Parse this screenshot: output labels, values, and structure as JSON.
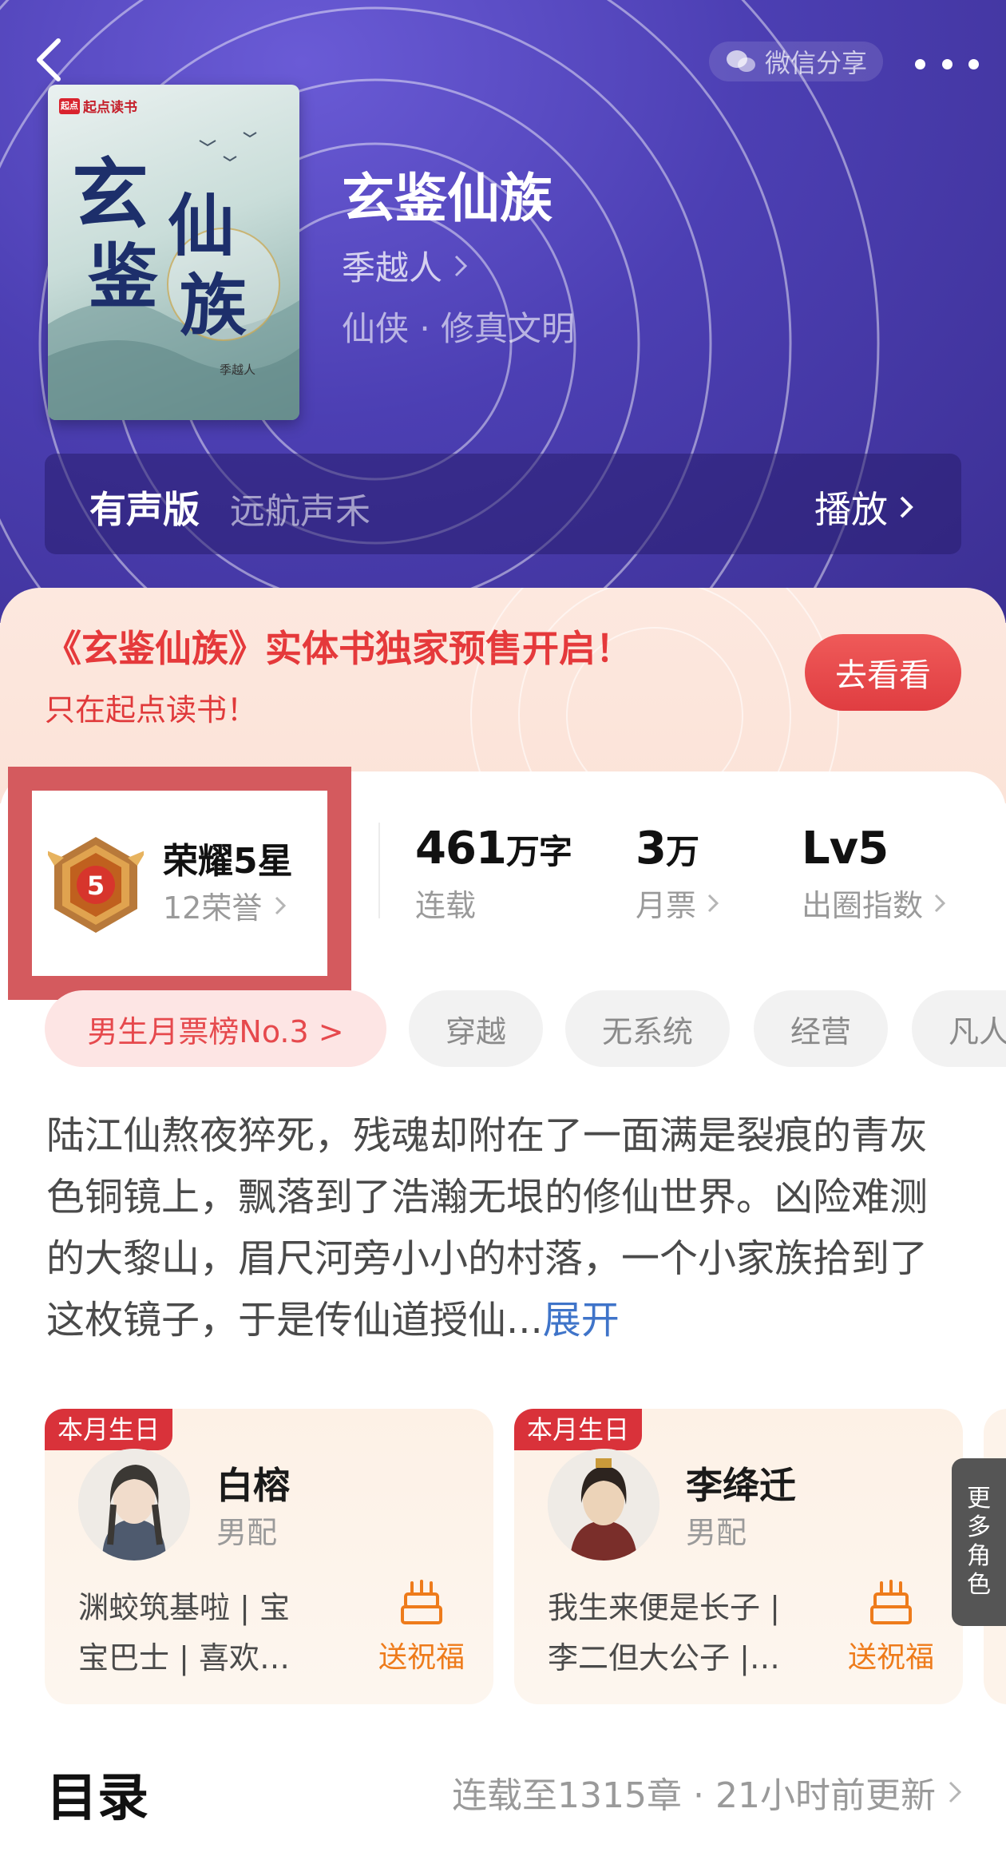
{
  "nav": {
    "share_label": "微信分享"
  },
  "book": {
    "cover_brand": "起点读书",
    "cover_brand_mark": "起点",
    "cover_title_chars": [
      "玄",
      "鉴",
      "仙",
      "族"
    ],
    "cover_author": "季越人",
    "title": "玄鉴仙族",
    "author": "季越人",
    "genre": "仙侠 · 修真文明"
  },
  "audio": {
    "label": "有声版",
    "narrator": "远航声禾",
    "play_label": "播放"
  },
  "promo": {
    "title": "《玄鉴仙族》实体书独家预售开启！",
    "subtitle": "只在起点读书！",
    "button": "去看看"
  },
  "honor": {
    "title": "荣耀5星",
    "subtitle": "12荣誉",
    "medal_level": "5"
  },
  "stats": [
    {
      "value": "461",
      "unit": "万字",
      "label": "连载"
    },
    {
      "value": "3",
      "unit": "万",
      "label": "月票"
    },
    {
      "value": "Lv5",
      "unit": "",
      "label": "出圈指数"
    }
  ],
  "tags": [
    "男生月票榜No.3 >",
    "穿越",
    "无系统",
    "经营",
    "凡人"
  ],
  "synopsis": {
    "text": "陆江仙熬夜猝死，残魂却附在了一面满是裂痕的青灰色铜镜上，飘落到了浩瀚无垠的修仙世界。凶险难测的大黎山，眉尺河旁小小的村落，一个小家族拾到了这枚镜子，于是传仙道授仙...",
    "expand": "展开"
  },
  "characters": [
    {
      "badge": "本月生日",
      "name": "白榕",
      "role": "男配",
      "desc_line1": "渊蛟筑基啦 | 宝",
      "desc_line2": "宝巴士 | 喜欢…",
      "bless": "送祝福"
    },
    {
      "badge": "本月生日",
      "name": "李绛迁",
      "role": "男配",
      "desc_line1": "我生来便是长子 |",
      "desc_line2": "李二但大公子 |…",
      "bless": "送祝福"
    }
  ],
  "more_roles": [
    "更",
    "多",
    "角",
    "色"
  ],
  "toc": {
    "title": "目录",
    "info": "连载至1315章 · 21小时前更新"
  },
  "colors": {
    "hero_bg": "#4c3fb3",
    "accent_red": "#e5393b",
    "link_blue": "#3f74c9",
    "bless_orange": "#ee7b1b",
    "highlight_box": "#d45a5e"
  }
}
